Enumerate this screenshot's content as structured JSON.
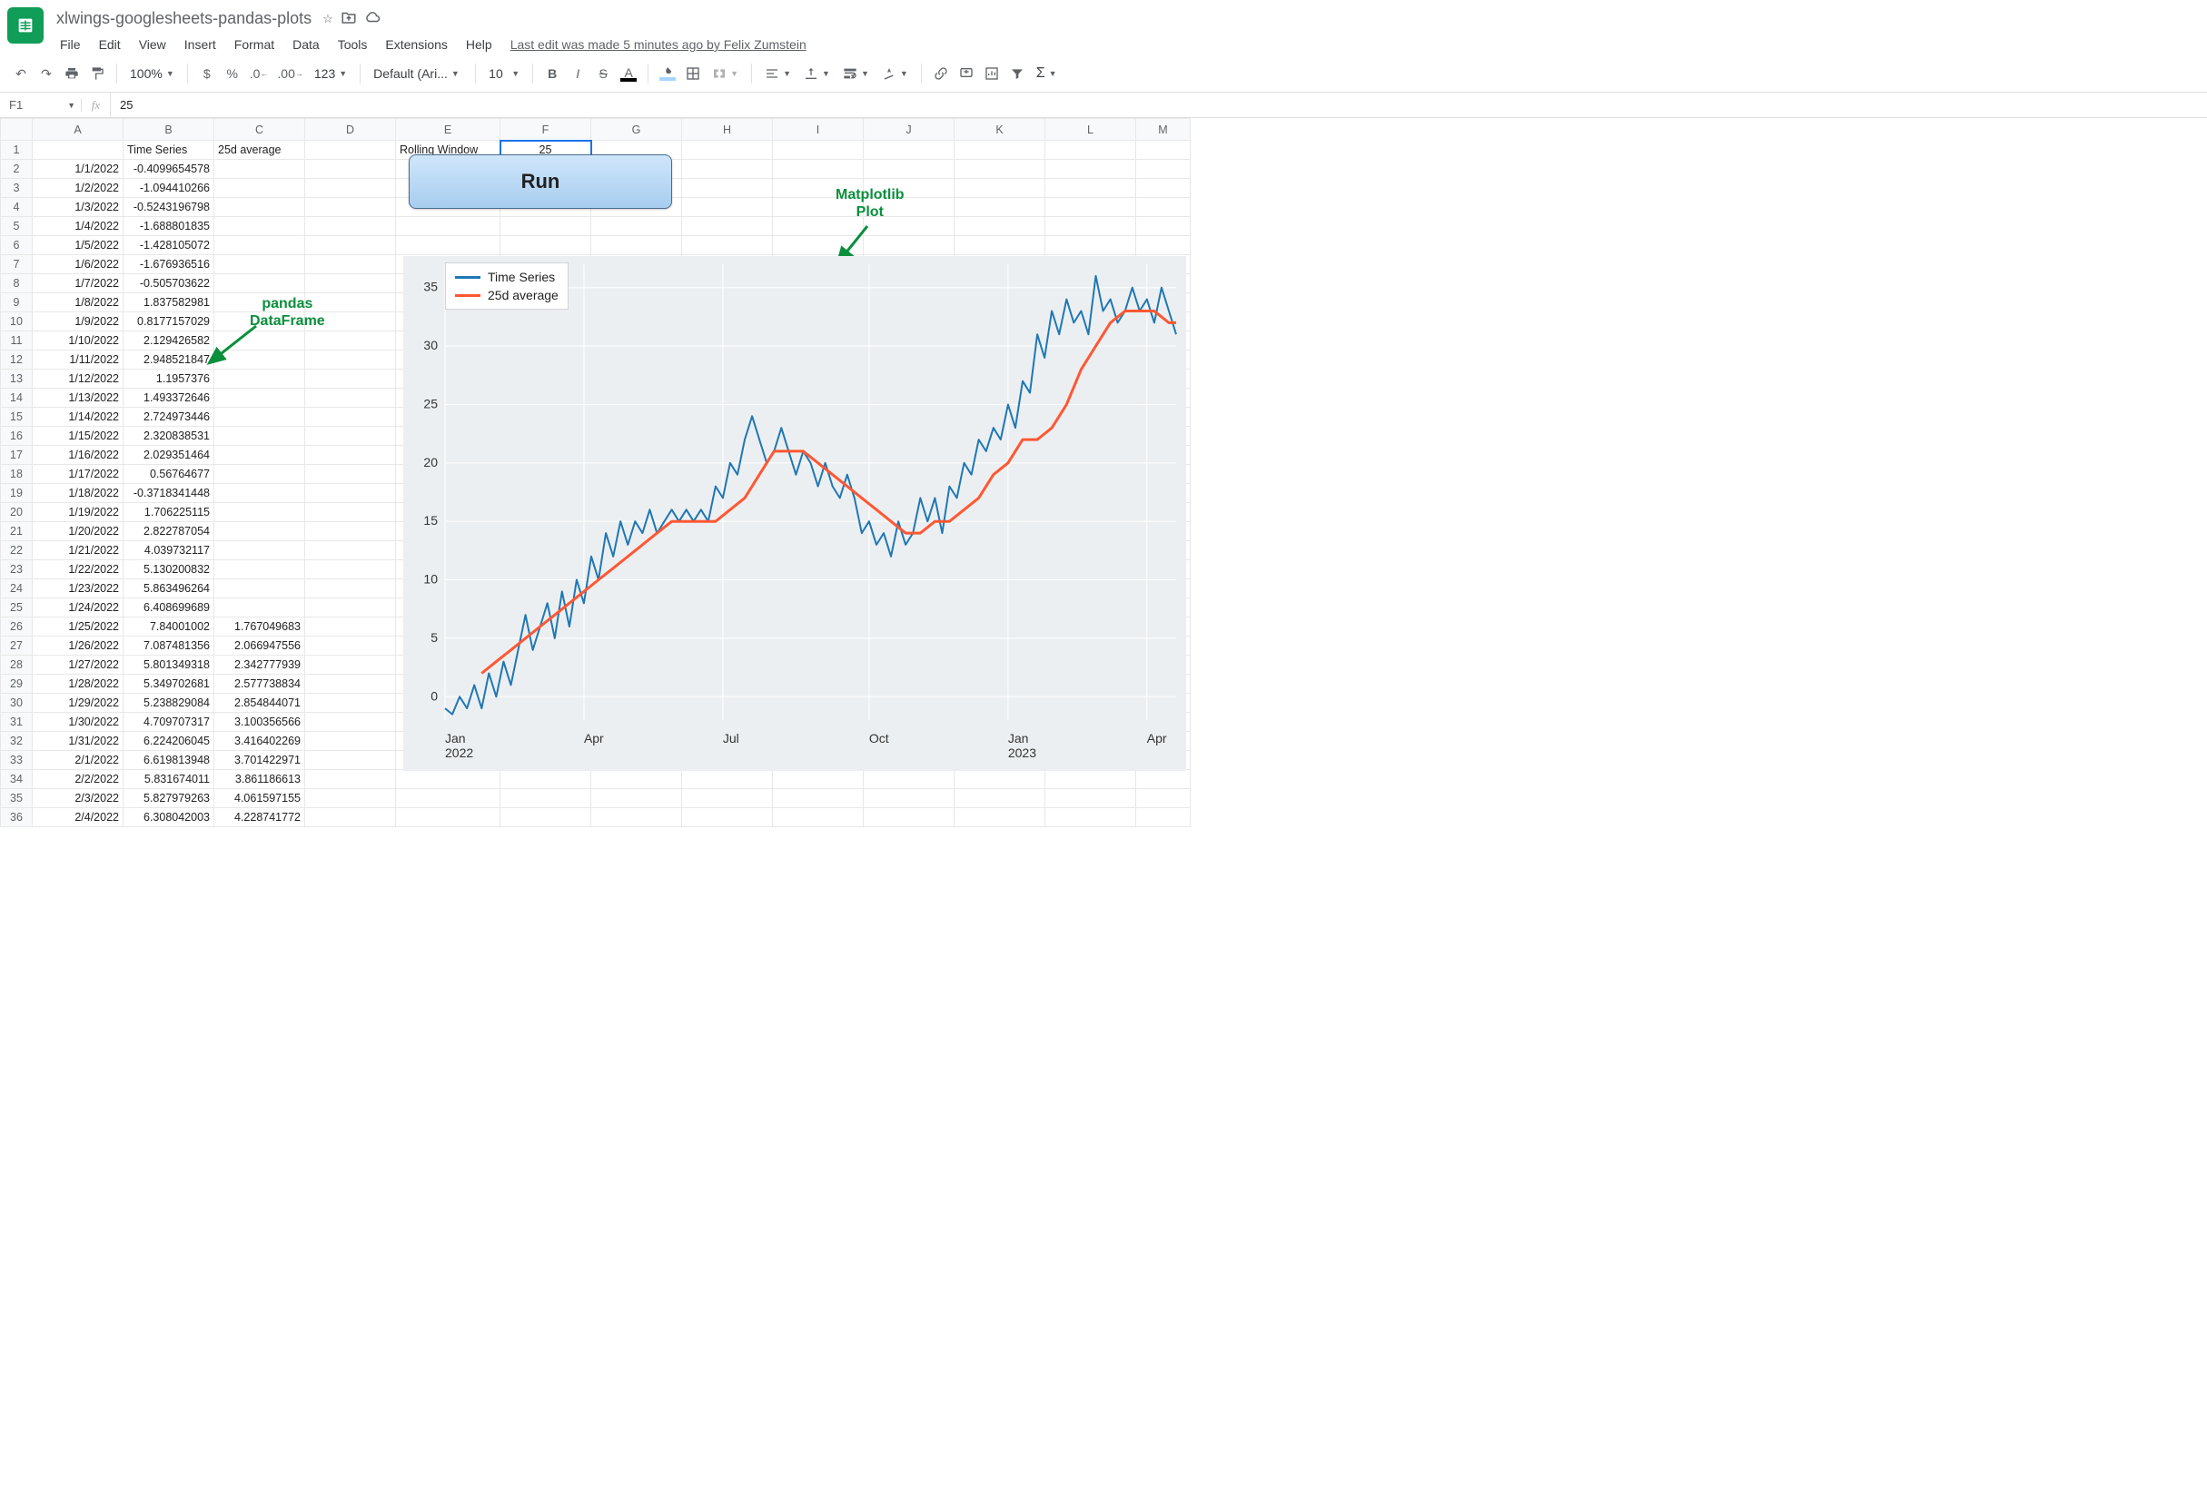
{
  "doc": {
    "title": "xlwings-googlesheets-pandas-plots"
  },
  "menus": [
    "File",
    "Edit",
    "View",
    "Insert",
    "Format",
    "Data",
    "Tools",
    "Extensions",
    "Help"
  ],
  "last_edit": "Last edit was made 5 minutes ago by Felix Zumstein",
  "toolbar": {
    "zoom": "100%",
    "font": "Default (Ari...",
    "font_size": "10"
  },
  "namebox": "F1",
  "formula": "25",
  "columns": [
    "A",
    "B",
    "C",
    "D",
    "E",
    "F",
    "G",
    "H",
    "I",
    "J",
    "K",
    "L",
    "M"
  ],
  "labels": {
    "time_series": "Time Series",
    "avg_header": "25d average",
    "rolling": "Rolling Window",
    "rolling_value": "25"
  },
  "run_btn": "Run",
  "annotations": {
    "pandas": "pandas\nDataFrame",
    "mpl": "Matplotlib\nPlot"
  },
  "rows": [
    {
      "n": 1,
      "A": "",
      "B_label": true,
      "C_label": true,
      "E_label": true,
      "F_sel": true
    },
    {
      "n": 2,
      "A": "1/1/2022",
      "B": "-0.4099654578"
    },
    {
      "n": 3,
      "A": "1/2/2022",
      "B": "-1.094410266"
    },
    {
      "n": 4,
      "A": "1/3/2022",
      "B": "-0.5243196798"
    },
    {
      "n": 5,
      "A": "1/4/2022",
      "B": "-1.688801835"
    },
    {
      "n": 6,
      "A": "1/5/2022",
      "B": "-1.428105072"
    },
    {
      "n": 7,
      "A": "1/6/2022",
      "B": "-1.676936516"
    },
    {
      "n": 8,
      "A": "1/7/2022",
      "B": "-0.505703622"
    },
    {
      "n": 9,
      "A": "1/8/2022",
      "B": "1.837582981"
    },
    {
      "n": 10,
      "A": "1/9/2022",
      "B": "0.8177157029"
    },
    {
      "n": 11,
      "A": "1/10/2022",
      "B": "2.129426582"
    },
    {
      "n": 12,
      "A": "1/11/2022",
      "B": "2.948521847"
    },
    {
      "n": 13,
      "A": "1/12/2022",
      "B": "1.1957376"
    },
    {
      "n": 14,
      "A": "1/13/2022",
      "B": "1.493372646"
    },
    {
      "n": 15,
      "A": "1/14/2022",
      "B": "2.724973446"
    },
    {
      "n": 16,
      "A": "1/15/2022",
      "B": "2.320838531"
    },
    {
      "n": 17,
      "A": "1/16/2022",
      "B": "2.029351464"
    },
    {
      "n": 18,
      "A": "1/17/2022",
      "B": "0.56764677"
    },
    {
      "n": 19,
      "A": "1/18/2022",
      "B": "-0.3718341448"
    },
    {
      "n": 20,
      "A": "1/19/2022",
      "B": "1.706225115"
    },
    {
      "n": 21,
      "A": "1/20/2022",
      "B": "2.822787054"
    },
    {
      "n": 22,
      "A": "1/21/2022",
      "B": "4.039732117"
    },
    {
      "n": 23,
      "A": "1/22/2022",
      "B": "5.130200832"
    },
    {
      "n": 24,
      "A": "1/23/2022",
      "B": "5.863496264"
    },
    {
      "n": 25,
      "A": "1/24/2022",
      "B": "6.408699689"
    },
    {
      "n": 26,
      "A": "1/25/2022",
      "B": "7.84001002",
      "C": "1.767049683"
    },
    {
      "n": 27,
      "A": "1/26/2022",
      "B": "7.087481356",
      "C": "2.066947556"
    },
    {
      "n": 28,
      "A": "1/27/2022",
      "B": "5.801349318",
      "C": "2.342777939"
    },
    {
      "n": 29,
      "A": "1/28/2022",
      "B": "5.349702681",
      "C": "2.577738834"
    },
    {
      "n": 30,
      "A": "1/29/2022",
      "B": "5.238829084",
      "C": "2.854844071"
    },
    {
      "n": 31,
      "A": "1/30/2022",
      "B": "4.709707317",
      "C": "3.100356566"
    },
    {
      "n": 32,
      "A": "1/31/2022",
      "B": "6.224206045",
      "C": "3.416402269"
    },
    {
      "n": 33,
      "A": "2/1/2022",
      "B": "6.619813948",
      "C": "3.701422971"
    },
    {
      "n": 34,
      "A": "2/2/2022",
      "B": "5.831674011",
      "C": "3.861186613"
    },
    {
      "n": 35,
      "A": "2/3/2022",
      "B": "5.827979263",
      "C": "4.061597155"
    },
    {
      "n": 36,
      "A": "2/4/2022",
      "B": "6.308042003",
      "C": "4.228741772"
    }
  ],
  "chart_data": {
    "type": "line",
    "title": "",
    "legend": [
      "Time Series",
      "25d average"
    ],
    "colors": {
      "ts": "#1f77b4",
      "avg": "#ff5733"
    },
    "yticks": [
      0,
      5,
      10,
      15,
      20,
      25,
      30,
      35
    ],
    "ylim": [
      -2,
      37
    ],
    "xticks": [
      {
        "label": "Jan",
        "year": "2022",
        "t": 0.0
      },
      {
        "label": "Apr",
        "year": "",
        "t": 0.19
      },
      {
        "label": "Jul",
        "year": "",
        "t": 0.38
      },
      {
        "label": "Oct",
        "year": "",
        "t": 0.58
      },
      {
        "label": "Jan",
        "year": "2023",
        "t": 0.77
      },
      {
        "label": "Apr",
        "year": "",
        "t": 0.96
      }
    ],
    "series": [
      {
        "name": "Time Series",
        "t": [
          0.0,
          0.01,
          0.02,
          0.03,
          0.04,
          0.05,
          0.06,
          0.07,
          0.08,
          0.09,
          0.1,
          0.11,
          0.12,
          0.13,
          0.14,
          0.15,
          0.16,
          0.17,
          0.18,
          0.19,
          0.2,
          0.21,
          0.22,
          0.23,
          0.24,
          0.25,
          0.26,
          0.27,
          0.28,
          0.29,
          0.3,
          0.31,
          0.32,
          0.33,
          0.34,
          0.35,
          0.36,
          0.37,
          0.38,
          0.39,
          0.4,
          0.41,
          0.42,
          0.43,
          0.44,
          0.45,
          0.46,
          0.47,
          0.48,
          0.49,
          0.5,
          0.51,
          0.52,
          0.53,
          0.54,
          0.55,
          0.56,
          0.57,
          0.58,
          0.59,
          0.6,
          0.61,
          0.62,
          0.63,
          0.64,
          0.65,
          0.66,
          0.67,
          0.68,
          0.69,
          0.7,
          0.71,
          0.72,
          0.73,
          0.74,
          0.75,
          0.76,
          0.77,
          0.78,
          0.79,
          0.8,
          0.81,
          0.82,
          0.83,
          0.84,
          0.85,
          0.86,
          0.87,
          0.88,
          0.89,
          0.9,
          0.91,
          0.92,
          0.93,
          0.94,
          0.95,
          0.96,
          0.97,
          0.98,
          0.99,
          1.0
        ],
        "y": [
          -1,
          -1.5,
          0,
          -1,
          1,
          -1,
          2,
          0,
          3,
          1,
          4,
          7,
          4,
          6,
          8,
          5,
          9,
          6,
          10,
          8,
          12,
          10,
          14,
          12,
          15,
          13,
          15,
          14,
          16,
          14,
          15,
          16,
          15,
          16,
          15,
          16,
          15,
          18,
          17,
          20,
          19,
          22,
          24,
          22,
          20,
          21,
          23,
          21,
          19,
          21,
          20,
          18,
          20,
          18,
          17,
          19,
          17,
          14,
          15,
          13,
          14,
          12,
          15,
          13,
          14,
          17,
          15,
          17,
          14,
          18,
          17,
          20,
          19,
          22,
          21,
          23,
          22,
          25,
          23,
          27,
          26,
          31,
          29,
          33,
          31,
          34,
          32,
          33,
          31,
          36,
          33,
          34,
          32,
          33,
          35,
          33,
          34,
          32,
          35,
          33,
          31
        ]
      },
      {
        "name": "25d average",
        "t": [
          0.05,
          0.07,
          0.09,
          0.11,
          0.13,
          0.15,
          0.17,
          0.19,
          0.21,
          0.23,
          0.25,
          0.27,
          0.29,
          0.31,
          0.33,
          0.35,
          0.37,
          0.39,
          0.41,
          0.43,
          0.45,
          0.47,
          0.49,
          0.51,
          0.53,
          0.55,
          0.57,
          0.59,
          0.61,
          0.63,
          0.65,
          0.67,
          0.69,
          0.71,
          0.73,
          0.75,
          0.77,
          0.79,
          0.81,
          0.83,
          0.85,
          0.87,
          0.89,
          0.91,
          0.93,
          0.95,
          0.97,
          0.99,
          1.0
        ],
        "y": [
          2,
          3,
          4,
          5,
          6,
          7,
          8,
          9,
          10,
          11,
          12,
          13,
          14,
          15,
          15,
          15,
          15,
          16,
          17,
          19,
          21,
          21,
          21,
          20,
          19,
          18,
          17,
          16,
          15,
          14,
          14,
          15,
          15,
          16,
          17,
          19,
          20,
          22,
          22,
          23,
          25,
          28,
          30,
          32,
          33,
          33,
          33,
          32,
          32
        ]
      }
    ]
  }
}
